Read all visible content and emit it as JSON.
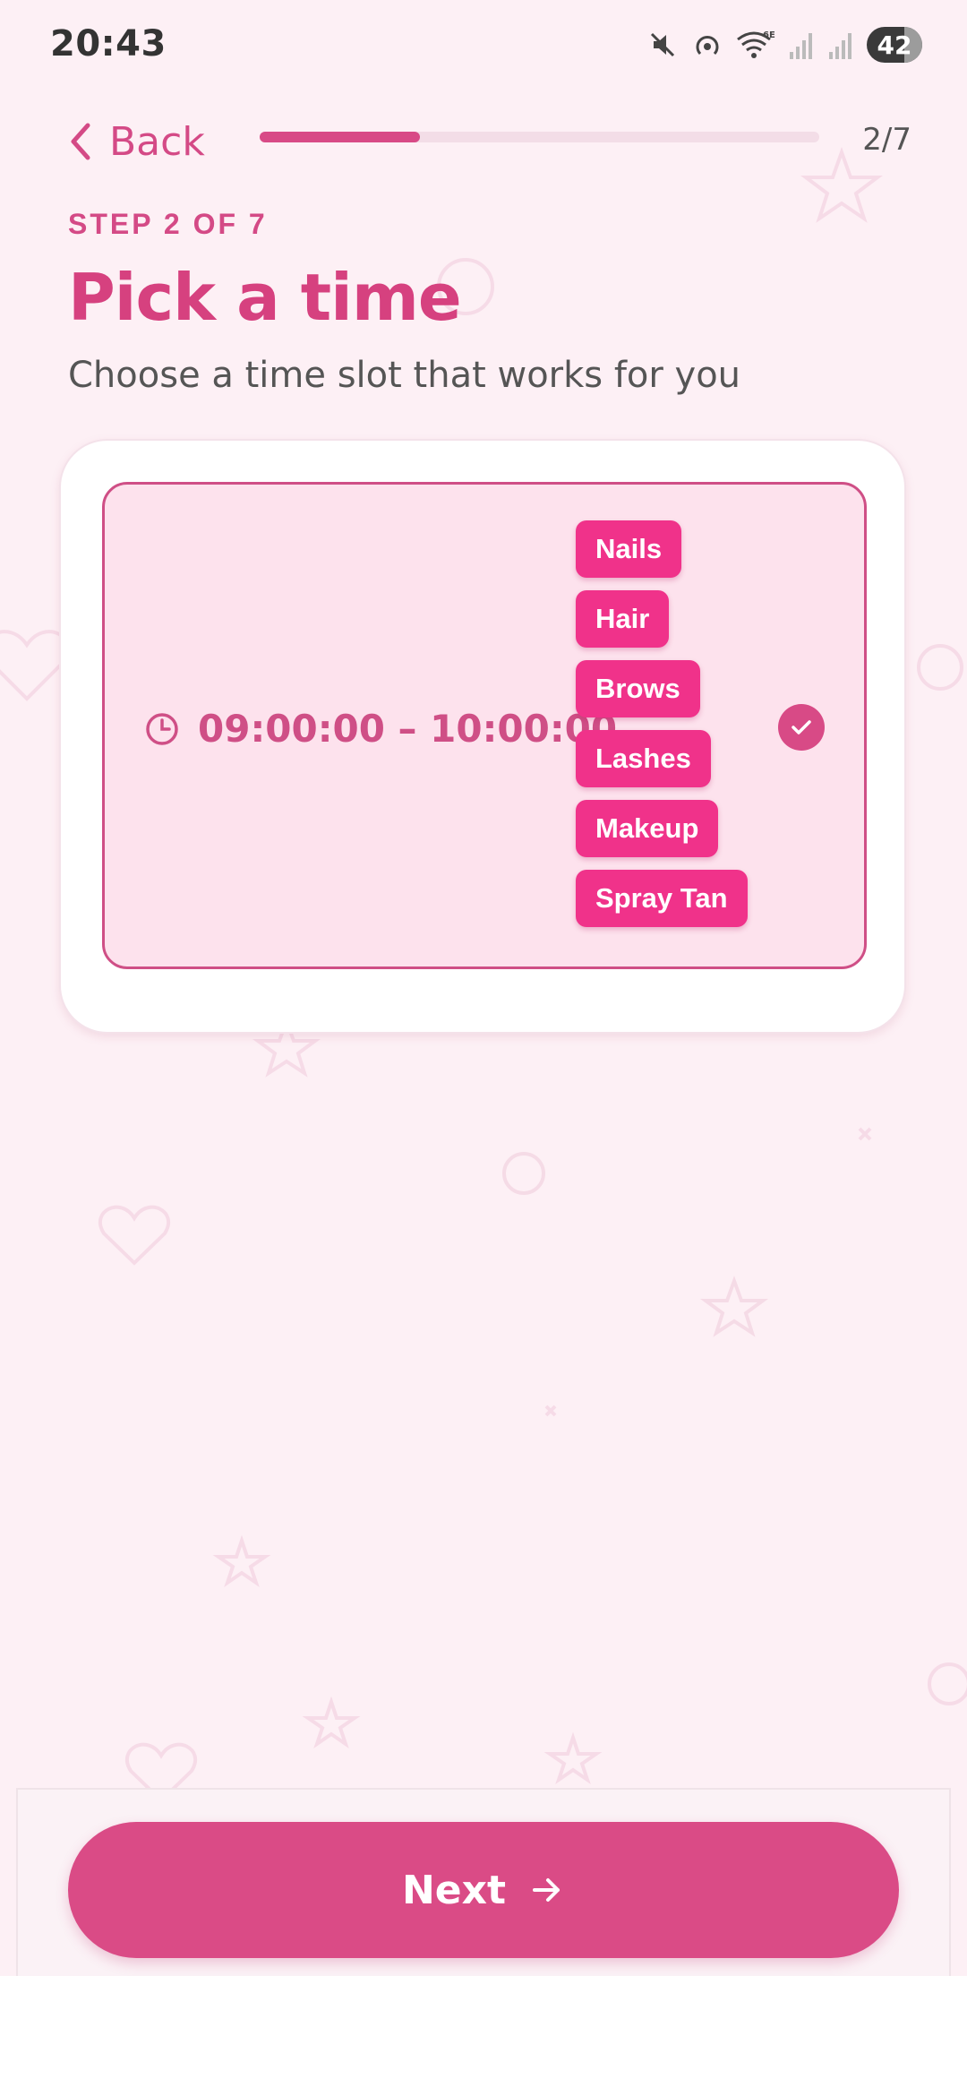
{
  "status_bar": {
    "time": "20:43",
    "battery": "42",
    "icons": [
      "mute-icon",
      "hotspot-icon",
      "wifi-6e-icon",
      "signal-icon",
      "signal-icon"
    ]
  },
  "nav": {
    "back_label": "Back",
    "step_counter": "2/7",
    "progress_fraction": 0.286
  },
  "header": {
    "step_label": "STEP 2 OF 7",
    "title": "Pick a time",
    "subtitle": "Choose a time slot that works for you"
  },
  "slot": {
    "time_range": "09:00:00 – 10:00:00",
    "selected": true,
    "services": [
      "Nails",
      "Hair",
      "Brows",
      "Lashes",
      "Makeup",
      "Spray Tan"
    ]
  },
  "footer": {
    "next_label": "Next"
  },
  "colors": {
    "accent": "#d84a86",
    "tag": "#f0328a",
    "slot_bg": "#fde2ed",
    "background": "#fdf0f5"
  }
}
